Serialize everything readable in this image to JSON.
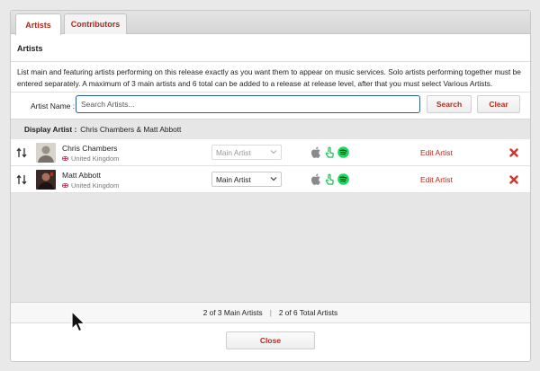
{
  "tabs": [
    {
      "label": "Artists",
      "active": true
    },
    {
      "label": "Contributors",
      "active": false
    }
  ],
  "section": {
    "title": "Artists",
    "description": "List main and featuring artists performing on this release exactly as you want them to appear on music services. Solo artists performing together must be entered separately. A maximum of 3 main artists and 6 total can be added to a release at release level, after that you must select Various Artists."
  },
  "search": {
    "label": "Artist Name :",
    "placeholder": "Search Artists...",
    "value": "",
    "search_button": "Search",
    "clear_button": "Clear"
  },
  "display_artist": {
    "label": "Display Artist :",
    "value": "Chris Chambers & Matt Abbott"
  },
  "artists": [
    {
      "name": "Chris Chambers",
      "country": "United Kingdom",
      "role": "Main Artist",
      "role_disabled": true,
      "edit_label": "Edit Artist",
      "services": [
        "apple-music-icon",
        "tap-icon",
        "spotify-icon"
      ]
    },
    {
      "name": "Matt Abbott",
      "country": "United Kingdom",
      "role": "Main Artist",
      "role_disabled": false,
      "edit_label": "Edit Artist",
      "services": [
        "apple-music-icon",
        "tap-icon",
        "spotify-icon"
      ]
    }
  ],
  "counts": {
    "main": "2 of 3 Main Artists",
    "separator": "|",
    "total": "2 of 6 Total Artists"
  },
  "close_button": "Close",
  "colors": {
    "accent": "#b22b1e",
    "input_focus": "#2f5d9a",
    "spotify": "#1ed760",
    "panel_bg": "#e6e6e6"
  }
}
